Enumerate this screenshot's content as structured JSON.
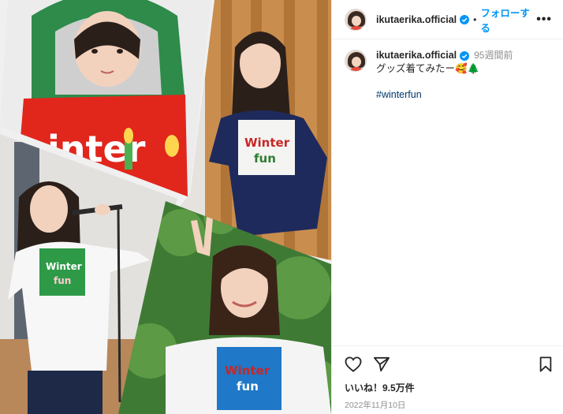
{
  "post": {
    "username": "ikutaerika.official",
    "follow_separator": "•",
    "follow_label": "フォローする",
    "more_label": "•••",
    "caption": {
      "username": "ikutaerika.official",
      "time_ago": "95週間前",
      "text": "グッズ着てみたー🥰🌲",
      "hashtag": "#winterfun"
    },
    "likes": "いいね！9.5万件",
    "date": "2022年11月10日"
  },
  "colors": {
    "accent": "#0095f6",
    "verified": "#0095f6",
    "hashtag": "#00376b",
    "muted": "#8e8e8e"
  },
  "icons": {
    "like": "heart-icon",
    "share": "paper-plane-icon",
    "save": "bookmark-icon",
    "verified": "verified-badge-icon",
    "more": "more-options-icon"
  }
}
